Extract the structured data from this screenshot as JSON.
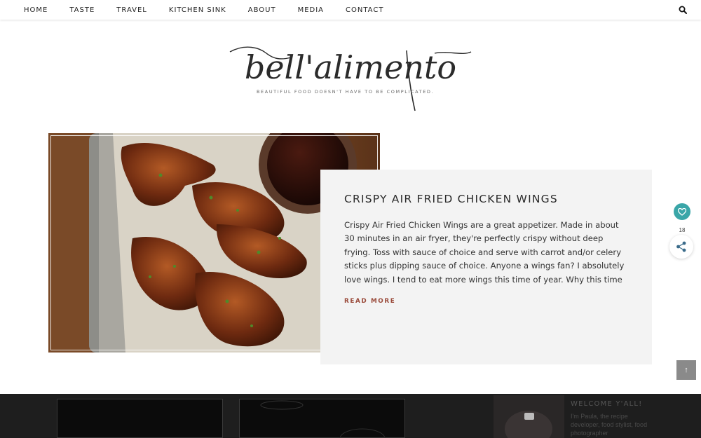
{
  "nav": {
    "items": [
      "HOME",
      "TASTE",
      "TRAVEL",
      "KITCHEN SINK",
      "ABOUT",
      "MEDIA",
      "CONTACT"
    ],
    "search_icon": "search-icon"
  },
  "logo": {
    "wordmark": "bell'alimento",
    "tagline": "BEAUTIFUL FOOD DOESN'T HAVE TO BE COMPLICATED."
  },
  "featured_post": {
    "title": "CRISPY AIR FRIED CHICKEN WINGS",
    "excerpt": "Crispy Air Fried Chicken Wings are a great appetizer. Made in about 30 minutes in an air fryer, they're perfectly crispy without deep frying. Toss with sauce of choice and serve with carrot and/or celery sticks plus dipping sauce of choice. Anyone a wings fan? I absolutely love wings. I tend to eat more wings this time of year. Why this time",
    "read_more": "READ MORE"
  },
  "share": {
    "count": "18",
    "heart_icon": "heart-icon",
    "share_icon": "share-icon"
  },
  "back_to_top": "↑",
  "sidebar": {
    "welcome_title": "WELCOME Y'ALL!",
    "welcome_text": "I'm Paula, the recipe developer, food stylist, food photographer"
  },
  "colors": {
    "accent_teal": "#3aa6a8",
    "read_more": "#9a4a3a",
    "card_bg": "#f3f3f3",
    "footer_band": "#1e1e1e"
  }
}
